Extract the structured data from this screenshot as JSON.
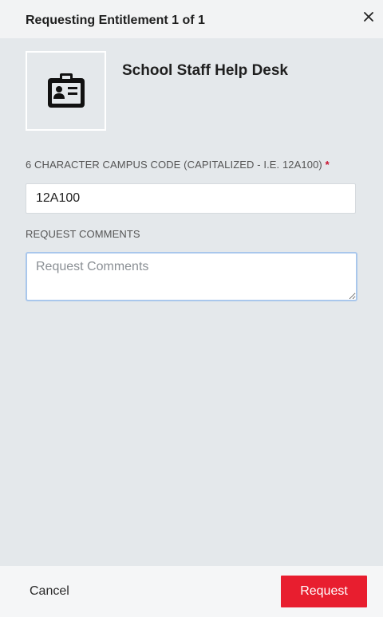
{
  "header": {
    "title": "Requesting Entitlement 1 of 1",
    "close_icon": "close-icon"
  },
  "item": {
    "name": "School Staff Help Desk",
    "icon": "id-badge-icon"
  },
  "form": {
    "campus_code": {
      "label": "6 CHARACTER CAMPUS CODE (CAPITALIZED - I.E. 12A100)",
      "required_marker": "*",
      "value": "12A100"
    },
    "comments": {
      "label": "REQUEST COMMENTS",
      "placeholder": "Request Comments",
      "value": ""
    }
  },
  "footer": {
    "cancel_label": "Cancel",
    "request_label": "Request"
  },
  "colors": {
    "accent": "#e81e2f",
    "required": "#c8102e",
    "focus_border": "#a9c7ec",
    "background": "#e4e8eb"
  }
}
